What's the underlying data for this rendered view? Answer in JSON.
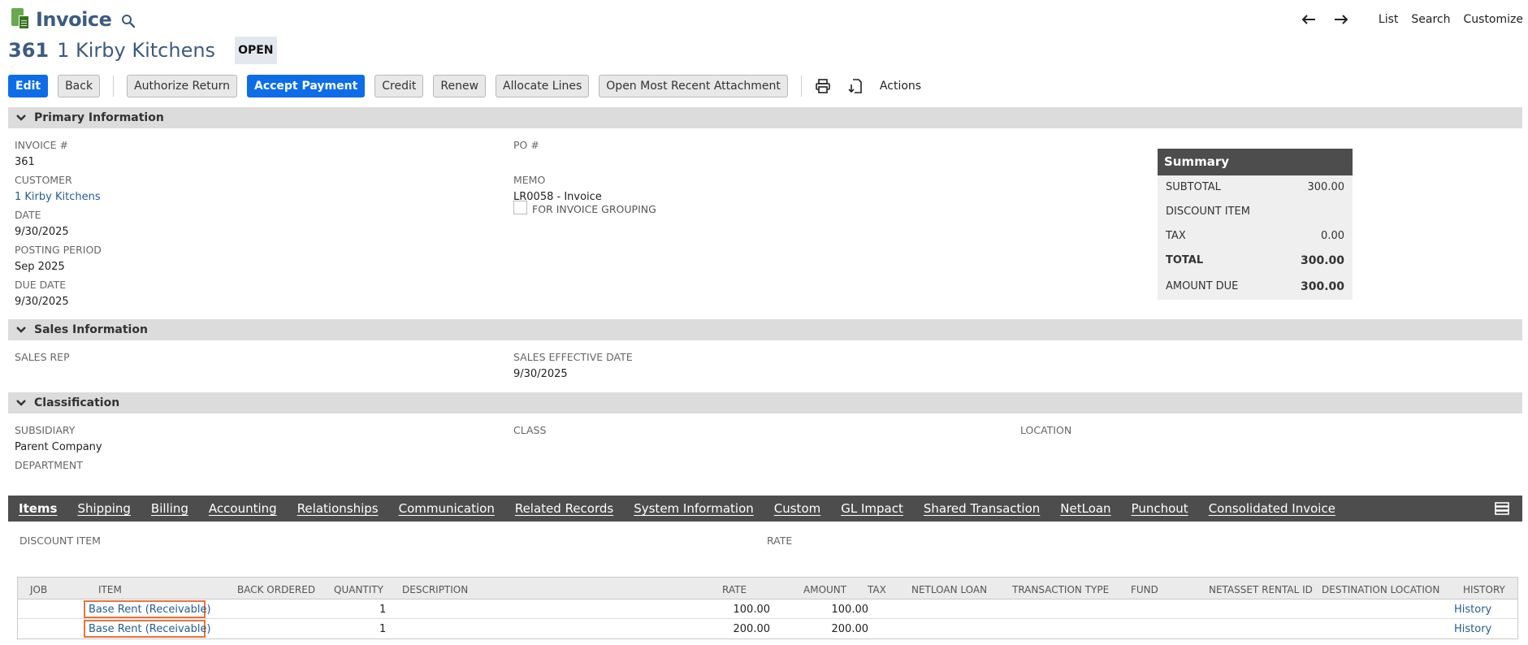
{
  "header": {
    "title": "Invoice",
    "record_number": "361",
    "record_name": "1 Kirby Kitchens",
    "status": "OPEN",
    "nav": {
      "list": "List",
      "search": "Search",
      "customize": "Customize"
    }
  },
  "toolbar": {
    "edit": "Edit",
    "back": "Back",
    "authorize_return": "Authorize Return",
    "accept_payment": "Accept Payment",
    "credit": "Credit",
    "renew": "Renew",
    "allocate_lines": "Allocate Lines",
    "open_attachment": "Open Most Recent Attachment",
    "actions": "Actions"
  },
  "sections": {
    "primary": "Primary Information",
    "sales": "Sales Information",
    "classification": "Classification"
  },
  "primary": {
    "invoice_label": "INVOICE #",
    "invoice_value": "361",
    "customer_label": "CUSTOMER",
    "customer_value": "1 Kirby Kitchens",
    "date_label": "DATE",
    "date_value": "9/30/2025",
    "posting_label": "POSTING PERIOD",
    "posting_value": "Sep 2025",
    "due_label": "DUE DATE",
    "due_value": "9/30/2025",
    "po_label": "PO #",
    "memo_label": "MEMO",
    "memo_value": "LR0058 - Invoice",
    "grouping_label": "FOR INVOICE GROUPING",
    "grouping_checked": false
  },
  "summary": {
    "title": "Summary",
    "subtotal_label": "SUBTOTAL",
    "subtotal": "300.00",
    "discount_label": "DISCOUNT ITEM",
    "tax_label": "TAX",
    "tax": "0.00",
    "total_label": "TOTAL",
    "total": "300.00",
    "amount_due_label": "AMOUNT DUE",
    "amount_due": "300.00"
  },
  "sales": {
    "rep_label": "SALES REP",
    "effective_label": "SALES EFFECTIVE DATE",
    "effective_value": "9/30/2025"
  },
  "classification": {
    "subsidiary_label": "SUBSIDIARY",
    "subsidiary_value": "Parent Company",
    "class_label": "CLASS",
    "location_label": "LOCATION",
    "department_label": "DEPARTMENT"
  },
  "tabs": [
    "Items",
    "Shipping",
    "Billing",
    "Accounting",
    "Relationships",
    "Communication",
    "Related Records",
    "System Information",
    "Custom",
    "GL Impact",
    "Shared Transaction",
    "NetLoan",
    "Punchout",
    "Consolidated Invoice"
  ],
  "items_tab": {
    "discount_label": "DISCOUNT ITEM",
    "rate_label": "RATE"
  },
  "grid": {
    "columns": [
      "JOB",
      "ITEM",
      "BACK ORDERED",
      "QUANTITY",
      "DESCRIPTION",
      "RATE",
      "AMOUNT",
      "TAX",
      "NETLOAN LOAN",
      "TRANSACTION TYPE",
      "FUND",
      "NETASSET RENTAL ID",
      "DESTINATION LOCATION",
      "HISTORY"
    ],
    "rows": [
      {
        "item": "Base Rent (Receivable)",
        "quantity": "1",
        "rate": "100.00",
        "amount": "100.00",
        "history": "History"
      },
      {
        "item": "Base Rent (Receivable)",
        "quantity": "1",
        "rate": "200.00",
        "amount": "200.00",
        "history": "History"
      }
    ]
  },
  "colors": {
    "accent": "#0d6de8",
    "title": "#3d5b80",
    "link": "#255d95",
    "highlight": "#e8743b"
  }
}
